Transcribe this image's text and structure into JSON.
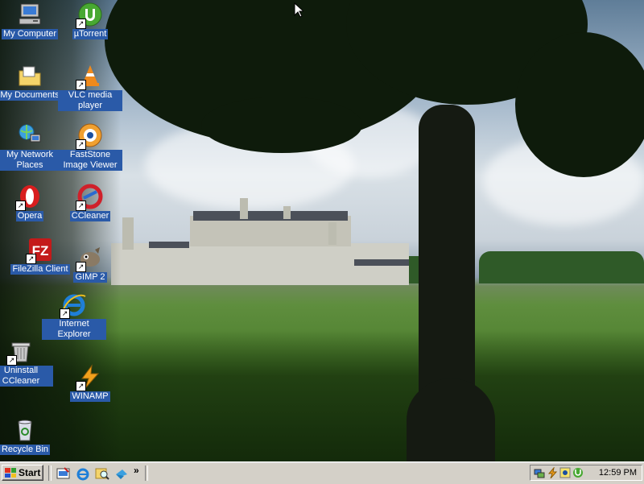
{
  "desktop": {
    "icons": [
      {
        "label": "My Computer",
        "icon": "computer-icon"
      },
      {
        "label": "µTorrent",
        "icon": "utorrent-icon"
      },
      {
        "label": "My Documents",
        "icon": "folder-icon"
      },
      {
        "label": "VLC media player",
        "icon": "vlc-cone-icon"
      },
      {
        "label": "My Network Places",
        "icon": "network-icon"
      },
      {
        "label": "FastStone Image Viewer",
        "icon": "faststone-icon"
      },
      {
        "label": "Opera",
        "icon": "opera-icon"
      },
      {
        "label": "CCleaner",
        "icon": "ccleaner-icon"
      },
      {
        "label": "FileZilla Client",
        "icon": "filezilla-icon"
      },
      {
        "label": "GIMP 2",
        "icon": "gimp-icon"
      },
      {
        "label": "Internet Explorer",
        "icon": "ie-icon"
      },
      {
        "label": "Uninstall CCleaner",
        "icon": "uninstall-icon"
      },
      {
        "label": "WINAMP",
        "icon": "winamp-icon"
      },
      {
        "label": "Recycle Bin",
        "icon": "recycle-bin-icon"
      }
    ]
  },
  "taskbar": {
    "start_label": "Start",
    "quick_launch_more": "»",
    "clock": "12:59 PM"
  },
  "colors": {
    "taskbar": "#d4d0c8",
    "icon_label_bg": "#2a5aa8"
  }
}
